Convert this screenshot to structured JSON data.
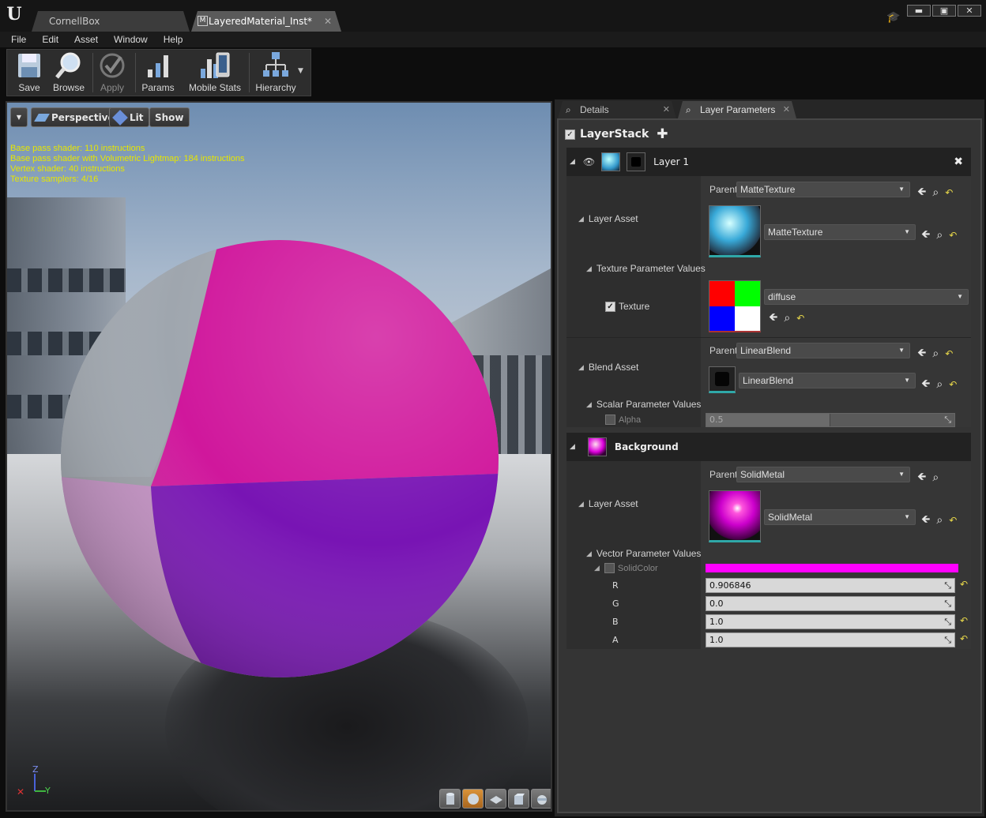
{
  "window": {
    "tabs": [
      {
        "label": "CornellBox"
      },
      {
        "label": "LayeredMaterial_Inst*"
      }
    ],
    "controls": {
      "minimize": "▬",
      "maximize": "▣",
      "close": "✕"
    }
  },
  "menu": [
    "File",
    "Edit",
    "Asset",
    "Window",
    "Help"
  ],
  "toolbar": {
    "save": "Save",
    "browse": "Browse",
    "apply": "Apply",
    "params": "Params",
    "mobile_stats": "Mobile Stats",
    "hierarchy": "Hierarchy"
  },
  "viewport": {
    "perspective": "Perspective",
    "lit": "Lit",
    "show": "Show",
    "stats": [
      "Base pass shader: 110 instructions",
      "Base pass shader with Volumetric Lightmap: 184 instructions",
      "Vertex shader: 40 instructions",
      "Texture samplers: 4/16"
    ],
    "axis_z": "Z",
    "axis_y": "Y"
  },
  "panel_tabs": {
    "details": "Details",
    "layer_parameters": "Layer Parameters"
  },
  "layer_stack": {
    "title": "LayerStack",
    "layer1": {
      "name": "Layer 1",
      "parent_label": "Parent",
      "parent_value": "MatteTexture",
      "layer_asset_label": "Layer Asset",
      "layer_asset_value": "MatteTexture",
      "texture_param_values_label": "Texture Parameter Values",
      "texture_label": "Texture",
      "texture_value": "diffuse",
      "blend_parent_value": "LinearBlend",
      "blend_asset_label": "Blend Asset",
      "blend_asset_value": "LinearBlend",
      "scalar_param_values_label": "Scalar Parameter Values",
      "alpha_label": "Alpha",
      "alpha_value": "0.5"
    },
    "background": {
      "name": "Background",
      "parent_label": "Parent",
      "parent_value": "SolidMetal",
      "layer_asset_label": "Layer Asset",
      "layer_asset_value": "SolidMetal",
      "vector_param_values_label": "Vector Parameter Values",
      "solid_color_label": "SolidColor",
      "solid_color_hex": "#ff00ff",
      "r_label": "R",
      "r_value": "0.906846",
      "g_label": "G",
      "g_value": "0.0",
      "b_label": "B",
      "b_value": "1.0",
      "a_label": "A",
      "a_value": "1.0"
    }
  },
  "colors": {
    "accent_reset": "#e8d84a",
    "solid_color": "#ff00ff"
  }
}
